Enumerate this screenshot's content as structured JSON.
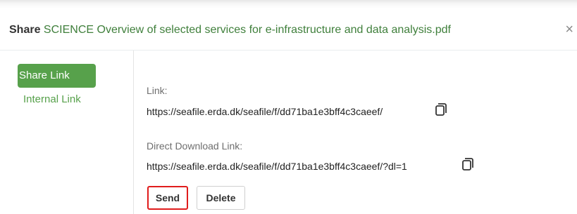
{
  "dialog": {
    "title_prefix": "Share",
    "file_name": "SCIENCE Overview of selected services for e-infrastructure and data analysis.pdf",
    "close_label": "×"
  },
  "sidebar": {
    "items": [
      {
        "label": "Share Link",
        "active": true
      },
      {
        "label": "Internal Link",
        "active": false
      }
    ]
  },
  "share_link": {
    "link_label": "Link:",
    "link_url": "https://seafile.erda.dk/seafile/f/dd71ba1e3bff4c3caeef/",
    "direct_label": "Direct Download Link:",
    "direct_url": "https://seafile.erda.dk/seafile/f/dd71ba1e3bff4c3caeef/?dl=1",
    "copy_icon": "copy-icon"
  },
  "actions": {
    "send_label": "Send",
    "delete_label": "Delete"
  },
  "colors": {
    "accent_green": "#57a14b",
    "highlight_red": "#e01c1c"
  }
}
